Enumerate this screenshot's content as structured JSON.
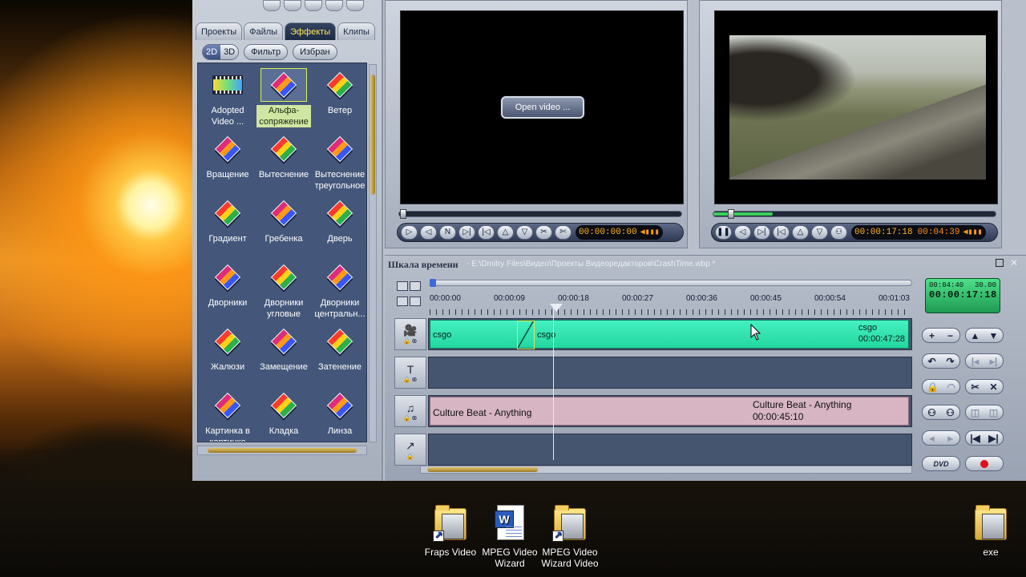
{
  "effects_panel": {
    "tabs": [
      "Проекты",
      "Файлы",
      "Эффекты",
      "Клипы"
    ],
    "active_tab_index": 2,
    "mode_2d": "2D",
    "mode_3d": "3D",
    "filter_label": "Фильтр",
    "favorites_label": "Избран",
    "items": [
      {
        "label": "Adopted Video ...",
        "icon": "filmstrip-icon"
      },
      {
        "label": "Альфа-сопряжение",
        "icon": "effect-cube-icon",
        "selected": true
      },
      {
        "label": "Ветер",
        "icon": "effect-cube-icon"
      },
      {
        "label": "Вращение",
        "icon": "effect-cube-icon"
      },
      {
        "label": "Вытеснение",
        "icon": "effect-cube-icon"
      },
      {
        "label": "Вытеснение треугольное",
        "icon": "effect-cube-icon"
      },
      {
        "label": "Градиент",
        "icon": "effect-cube-icon"
      },
      {
        "label": "Гребенка",
        "icon": "effect-cube-icon"
      },
      {
        "label": "Дверь",
        "icon": "effect-cube-icon"
      },
      {
        "label": "Дворники",
        "icon": "effect-cube-icon"
      },
      {
        "label": "Дворники угловые",
        "icon": "effect-cube-icon"
      },
      {
        "label": "Дворники центральн...",
        "icon": "effect-cube-icon"
      },
      {
        "label": "Жалюзи",
        "icon": "effect-cube-icon"
      },
      {
        "label": "Замещение",
        "icon": "effect-cube-icon"
      },
      {
        "label": "Затенение",
        "icon": "effect-cube-icon"
      },
      {
        "label": "Картинка в картинке",
        "icon": "effect-cube-icon"
      },
      {
        "label": "Кладка",
        "icon": "effect-cube-icon"
      },
      {
        "label": "Линза",
        "icon": "effect-cube-icon"
      }
    ]
  },
  "source_monitor": {
    "open_button_label": "Open video ...",
    "timecode": "00:00:00:00"
  },
  "preview_monitor": {
    "timecode": "00:00:17:18",
    "duration": "00:04:39",
    "progress_fraction": 0.06
  },
  "timeline": {
    "title": "Шкала времени",
    "path": "- E:\\Dmitry Files\\Видео\\Проекты Видеоредакторов\\CrashTime.wbp *",
    "ruler_ticks": [
      "00:00:00",
      "00:00:09",
      "00:00:18",
      "00:00:27",
      "00:00:36",
      "00:00:45",
      "00:00:54",
      "00:01:03"
    ],
    "video_clip": {
      "label_a": "csgo",
      "label_b": "csgo",
      "label_end": "csgo",
      "duration": "00:00:47:28"
    },
    "audio_clip": {
      "label": "Culture Beat - Anything",
      "label_end": "Culture Beat - Anything",
      "duration": "00:00:45:10"
    },
    "counter": {
      "total": "00:04:40",
      "fps": "30.00",
      "current": "00:00:17:18"
    },
    "dvd_label": "DVD"
  },
  "desktop_icons": [
    {
      "label": "Fraps Video",
      "type": "folder"
    },
    {
      "label": "MPEG Video Wizard",
      "type": "document"
    },
    {
      "label": "MPEG Video Wizard Video",
      "type": "folder"
    },
    {
      "label": "exe",
      "type": "folder"
    }
  ],
  "colors": {
    "accent_tab_text": "#ffe65a",
    "video_clip": "#23d7a0",
    "audio_clip": "#d7b5c3",
    "counter_bg": "#1f9a52",
    "timecode": "#ffb32a",
    "record": "#e0101a"
  }
}
